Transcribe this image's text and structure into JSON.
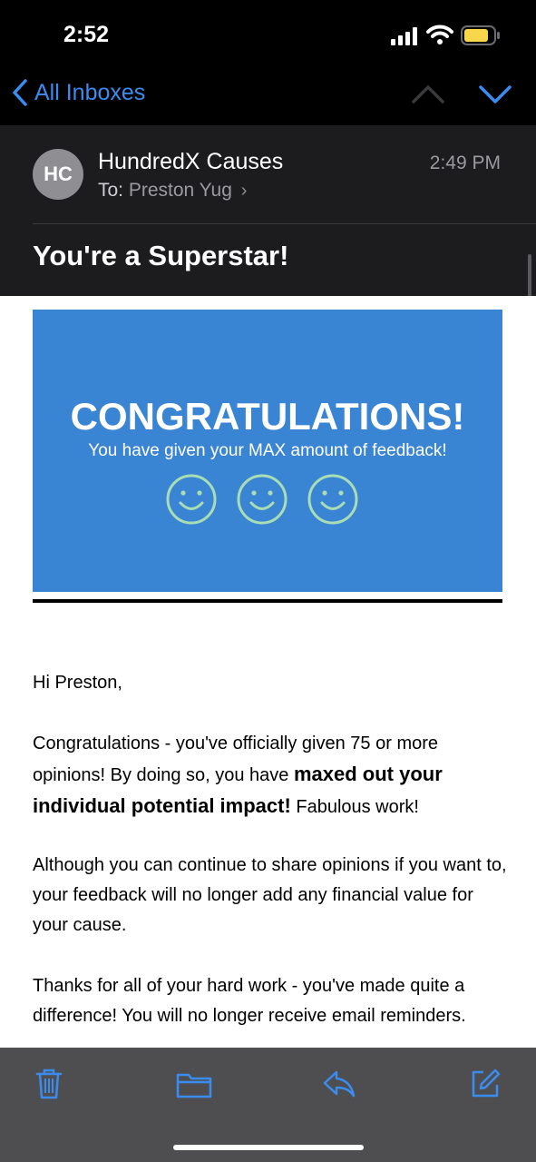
{
  "status_bar": {
    "time": "2:52"
  },
  "nav": {
    "back_label": "All Inboxes"
  },
  "message": {
    "avatar_initials": "HC",
    "sender": "HundredX Causes",
    "to_label": "To:",
    "recipient": "Preston Yug",
    "time": "2:49 PM",
    "subject": "You're a Superstar!"
  },
  "banner": {
    "headline": "CONGRATULATIONS!",
    "subline": "You have given your MAX amount of feedback!",
    "smiley_count": 3
  },
  "body": {
    "greeting": "Hi Preston,",
    "p1_a": "Congratulations - you've officially given 75 or more opinions! By doing so, you have ",
    "p1_bold": "maxed out your individual potential impact!",
    "p1_b": " Fabulous work!",
    "p2": "Although you can continue to share opinions if you want to, your feedback will no longer add any financial value for your cause.",
    "p3": "Thanks for all of your hard work - you've made quite a difference! You will no longer receive email reminders."
  },
  "colors": {
    "accent": "#3b8cf0",
    "banner": "#3a85d3",
    "smiley": "#a8ddb5"
  },
  "toolbar": {
    "icons": [
      "trash-icon",
      "folder-icon",
      "reply-icon",
      "compose-icon"
    ]
  }
}
